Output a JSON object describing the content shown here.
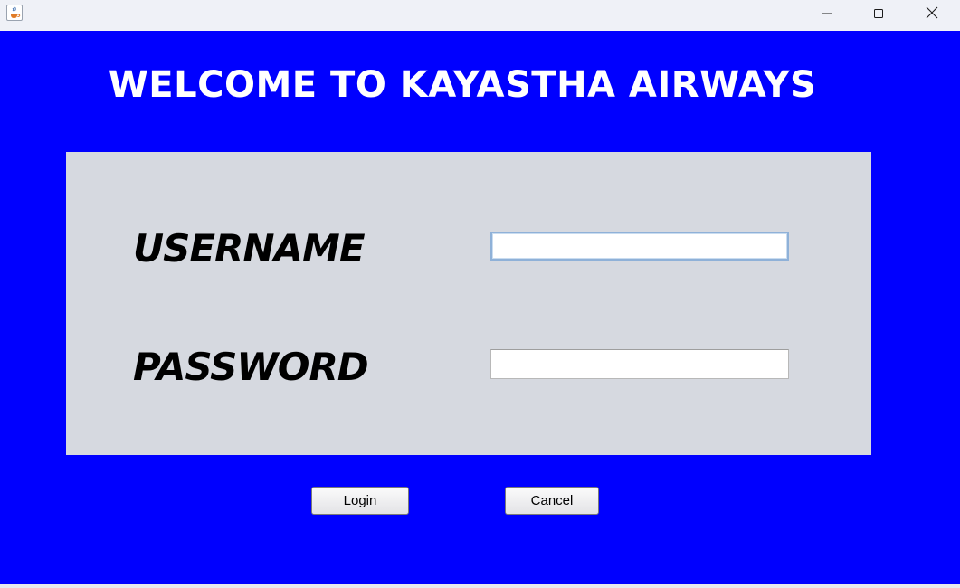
{
  "window": {
    "title": "",
    "icon": "java-cup-icon",
    "controls": [
      "minimize-icon",
      "maximize-icon",
      "close-icon"
    ]
  },
  "colors": {
    "background": "#0000ff",
    "panel": "#d6d9e0",
    "heading_text": "#ffffff",
    "label_text": "#000000"
  },
  "header": {
    "title": "WELCOME TO KAYASTHA AIRWAYS"
  },
  "form": {
    "username_label": "USERNAME",
    "username_value": "",
    "password_label": "PASSWORD",
    "password_value": ""
  },
  "buttons": {
    "login_label": "Login",
    "cancel_label": "Cancel"
  }
}
